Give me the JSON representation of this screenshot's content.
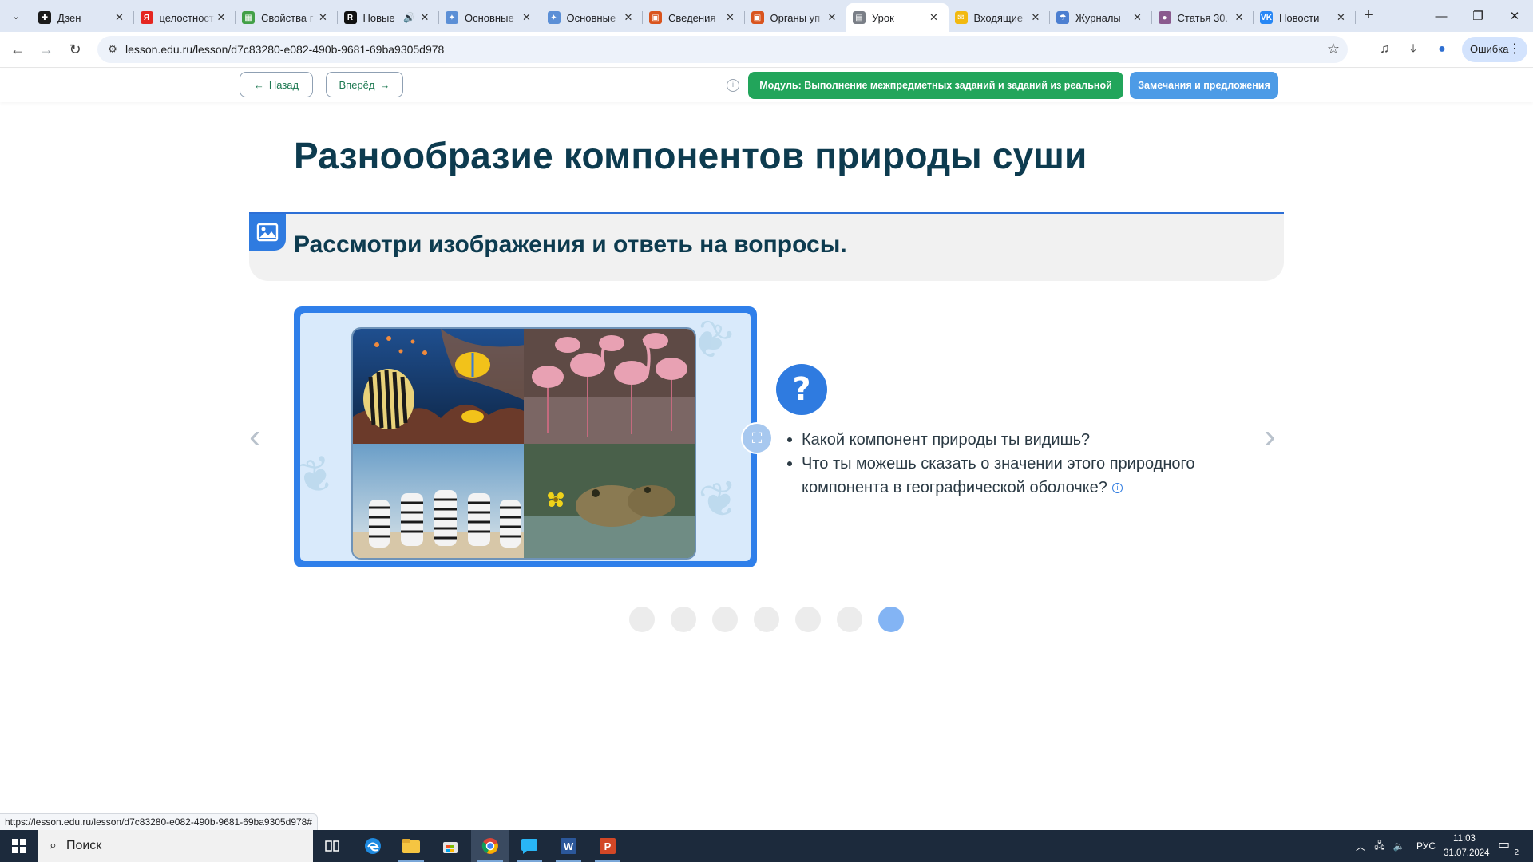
{
  "browser": {
    "tabs": [
      {
        "title": "Дзен",
        "favicon_color": "#1b1b1b",
        "favicon_glyph": "✚"
      },
      {
        "title": "целостность",
        "favicon_color": "#e52620",
        "favicon_glyph": "Я"
      },
      {
        "title": "Свойства г",
        "favicon_color": "#43a047",
        "favicon_glyph": "▦"
      },
      {
        "title": "Новые",
        "favicon_color": "#111111",
        "favicon_glyph": "R"
      },
      {
        "title": "Основные",
        "favicon_color": "#5b8fd6",
        "favicon_glyph": "✦"
      },
      {
        "title": "Основные",
        "favicon_color": "#5b8fd6",
        "favicon_glyph": "✦"
      },
      {
        "title": "Сведения",
        "favicon_color": "#d9541e",
        "favicon_glyph": "▣"
      },
      {
        "title": "Органы уп",
        "favicon_color": "#d9541e",
        "favicon_glyph": "▣"
      },
      {
        "title": "Урок",
        "favicon_color": "#7a7f87",
        "favicon_glyph": "▤"
      },
      {
        "title": "Входящие",
        "favicon_color": "#f2b90f",
        "favicon_glyph": "✉"
      },
      {
        "title": "Журналы",
        "favicon_color": "#4c7fd1",
        "favicon_glyph": "☂"
      },
      {
        "title": "Статья 30.",
        "favicon_color": "#8a5a8e",
        "favicon_glyph": "●"
      },
      {
        "title": "Новости",
        "favicon_color": "#2787f5",
        "favicon_glyph": "VK"
      }
    ],
    "active_tab_index": 8,
    "url": "lesson.edu.ru/lesson/d7c83280-e082-490b-9681-69ba9305d978",
    "profile_label": "Ошибка",
    "status_url": "https://lesson.edu.ru/lesson/d7c83280-e082-490b-9681-69ba9305d978#"
  },
  "lesson_bar": {
    "back_label": "Назад",
    "forward_label": "Вперёд",
    "module_label": "Модуль: Выполнение межпредметных заданий и заданий из реальной жизни",
    "remarks_label": "Замечания и предложения"
  },
  "content": {
    "title": "Разнообразие компонентов природы суши",
    "task": "Рассмотри изображения и ответь на вопросы.",
    "questions": [
      "Какой компонент природы ты видишь?",
      "Что ты можешь сказать о значении этого природного компонента в географической оболочке?"
    ],
    "image_tiles": [
      "fish-coral-reef",
      "flamingos",
      "zebras",
      "frogs"
    ],
    "pagination": {
      "total": 7,
      "current": 7
    }
  },
  "taskbar": {
    "search_placeholder": "Поиск",
    "language": "РУС",
    "time": "11:03",
    "date": "31.07.2024",
    "notifications": "2"
  }
}
